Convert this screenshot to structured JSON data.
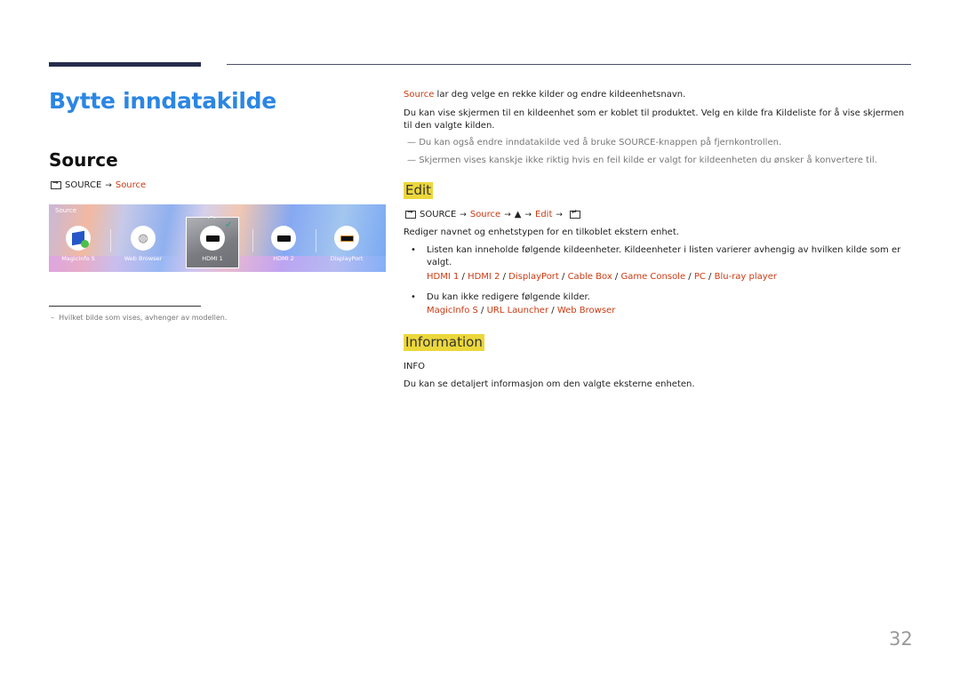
{
  "page": {
    "title": "Bytte inndatakilde",
    "section_title": "Source",
    "page_number": "32"
  },
  "left": {
    "menu_path": {
      "source_key": "SOURCE",
      "target": "Source"
    },
    "screenshot": {
      "title": "Source",
      "selected": "HDMI 1",
      "tiles": [
        {
          "label": "MagicInfo S",
          "icon": "magicinfo-icon"
        },
        {
          "label": "Web Browser",
          "icon": "globe-icon"
        },
        {
          "label": "HDMI 1",
          "icon": "hdmi-port-icon"
        },
        {
          "label": "HDMI 2",
          "icon": "hdmi-port-icon"
        },
        {
          "label": "DisplayPort",
          "icon": "displayport-icon"
        }
      ]
    },
    "footnote": "Hvilket bilde som vises, avhenger av modellen."
  },
  "right": {
    "intro_highlight": "Source",
    "intro_rest": " lar deg velge en rekke kilder og endre kildeenhetsnavn.",
    "para2": "Du kan vise skjermen til en kildeenhet som er koblet til produktet. Velg en kilde fra Kildeliste for å vise skjermen til den valgte kilden.",
    "notes": [
      "Du kan også endre inndatakilde ved å bruke SOURCE-knappen på fjernkontrollen.",
      "Skjermen vises kanskje ikke riktig hvis en feil kilde er valgt for kildeenheten du ønsker å konvertere til."
    ],
    "edit": {
      "heading": "Edit",
      "path": {
        "source_key": "SOURCE",
        "step1": "Source",
        "step2": "▲",
        "step3": "Edit"
      },
      "description": "Rediger navnet og enhetstypen for en tilkoblet ekstern enhet.",
      "bullet1": "Listen kan inneholde følgende kildeenheter. Kildeenheter i listen varierer avhengig av hvilken kilde som er valgt.",
      "bullet1_links": [
        "HDMI 1",
        "HDMI 2",
        "DisplayPort",
        "Cable Box",
        "Game Console",
        "PC",
        "Blu-ray player"
      ],
      "bullet2": "Du kan ikke redigere følgende kilder.",
      "bullet2_links": [
        "MagicInfo S",
        "URL Launcher",
        "Web Browser"
      ]
    },
    "information": {
      "heading": "Information",
      "key": "INFO",
      "description": "Du kan se detaljert informasjon om den valgte eksterne enheten."
    }
  }
}
